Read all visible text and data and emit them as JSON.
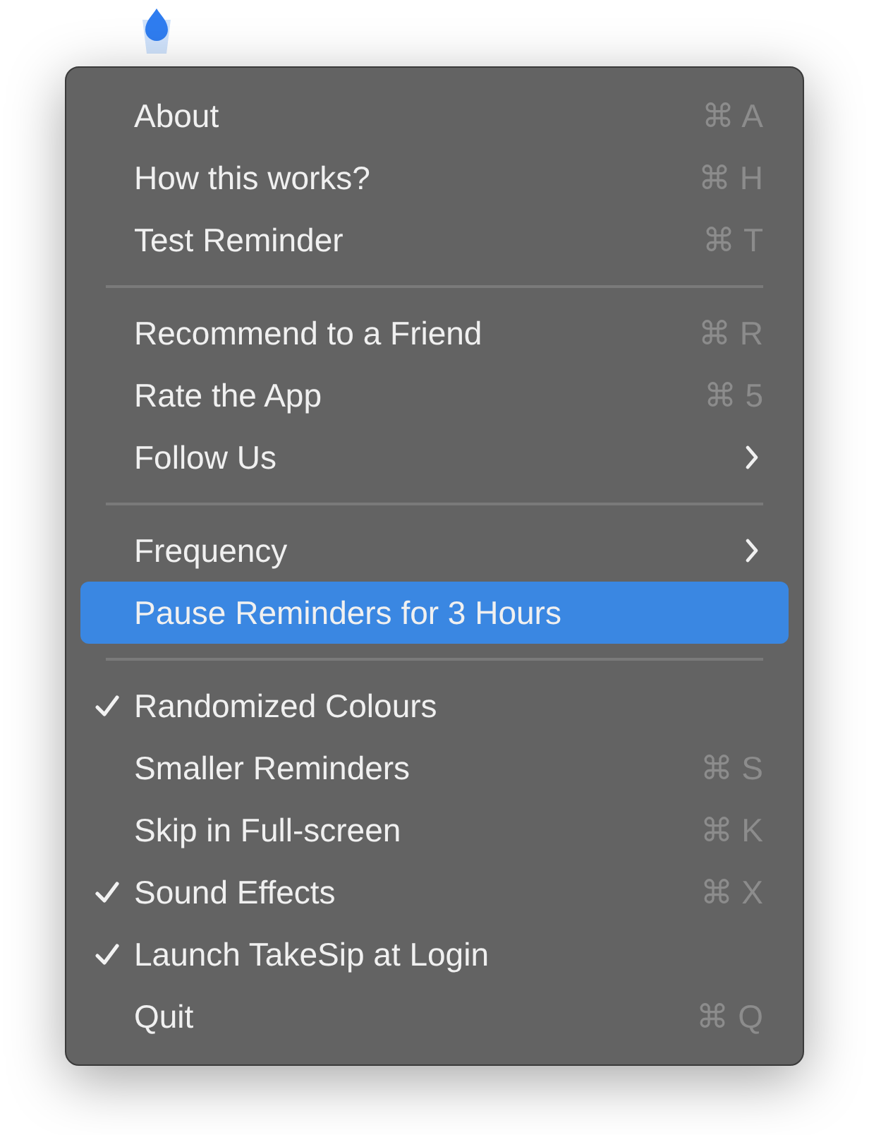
{
  "menu": {
    "sections": [
      {
        "items": [
          {
            "label": "About",
            "shortcut": "⌘ A",
            "checked": false,
            "selected": false,
            "submenu": false
          },
          {
            "label": "How this works?",
            "shortcut": "⌘ H",
            "checked": false,
            "selected": false,
            "submenu": false
          },
          {
            "label": "Test Reminder",
            "shortcut": "⌘ T",
            "checked": false,
            "selected": false,
            "submenu": false
          }
        ]
      },
      {
        "items": [
          {
            "label": "Recommend to a Friend",
            "shortcut": "⌘ R",
            "checked": false,
            "selected": false,
            "submenu": false
          },
          {
            "label": "Rate the App",
            "shortcut": "⌘ 5",
            "checked": false,
            "selected": false,
            "submenu": false
          },
          {
            "label": "Follow Us",
            "checked": false,
            "selected": false,
            "submenu": true
          }
        ]
      },
      {
        "items": [
          {
            "label": "Frequency",
            "checked": false,
            "selected": false,
            "submenu": true
          },
          {
            "label": "Pause Reminders for 3 Hours",
            "checked": false,
            "selected": true,
            "submenu": false
          }
        ]
      },
      {
        "items": [
          {
            "label": "Randomized Colours",
            "checked": true,
            "selected": false,
            "submenu": false
          },
          {
            "label": "Smaller Reminders",
            "shortcut": "⌘ S",
            "checked": false,
            "selected": false,
            "submenu": false
          },
          {
            "label": "Skip in Full-screen",
            "shortcut": "⌘ K",
            "checked": false,
            "selected": false,
            "submenu": false
          },
          {
            "label": "Sound Effects",
            "shortcut": "⌘ X",
            "checked": true,
            "selected": false,
            "submenu": false
          },
          {
            "label": "Launch TakeSip at Login",
            "checked": true,
            "selected": false,
            "submenu": false
          },
          {
            "label": "Quit",
            "shortcut": "⌘ Q",
            "checked": false,
            "selected": false,
            "submenu": false
          }
        ]
      }
    ]
  }
}
